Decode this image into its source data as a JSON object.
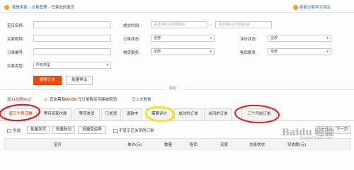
{
  "breadcrumb": {
    "seller": "我是卖家",
    "trade": "交易管理",
    "current": "已卖出的宝贝"
  },
  "help_link": "卖家交易学习专区",
  "form": {
    "item_name": {
      "label": "宝贝名称:"
    },
    "deal_time": {
      "label": "成交时间:",
      "start_placeholder": "请选择时间范围起始",
      "end_placeholder": "请选择时间范围结束"
    },
    "buyer": {
      "label": "买家昵称:"
    },
    "order_status": {
      "label": "订单状态:",
      "value": "全部"
    },
    "review_status": {
      "label": "评价状态:",
      "value": "全部"
    },
    "order_no": {
      "label": "订单编号:"
    },
    "logistics": {
      "label": "物流服务:",
      "value": "全部"
    },
    "after_sale": {
      "label": "售后服务:",
      "value": "全部"
    },
    "trade_type": {
      "label": "交易类型:",
      "value": "所有类型"
    },
    "search_button": "搜索订单",
    "export_button": "批量导出",
    "collapse": "收起"
  },
  "notice": {
    "prefix": "双11加购ing！",
    "text_a": "您急需有",
    "amount": "60.00",
    "text_b": "元订单购买可能被取消",
    "link": "马上去看看"
  },
  "tabs": [
    "近三个月订单",
    "等待买家付款",
    "等待发货",
    "已发货",
    "退款中",
    "需要评价",
    "成功的订单",
    "关闭的订单",
    "三个月前订单"
  ],
  "bulk": {
    "select_all": "全选",
    "ship": "批量发货",
    "mark": "批量标记",
    "free_review": "批量免运费",
    "hide_closed": "不显示已关闭的订单",
    "prev": "上一页",
    "next": "下一页"
  },
  "table": {
    "columns": [
      "宝贝",
      "单价(元)",
      "数量",
      "售后",
      "买家",
      "交易状态",
      "实收款(元)"
    ]
  },
  "watermark": "Baidu 经验",
  "watermark_url": "jingyan.baidu.com",
  "colors": {
    "accent": "#ff4400",
    "red_mark": "#e0201c",
    "yellow_mark": "#f5e400"
  }
}
